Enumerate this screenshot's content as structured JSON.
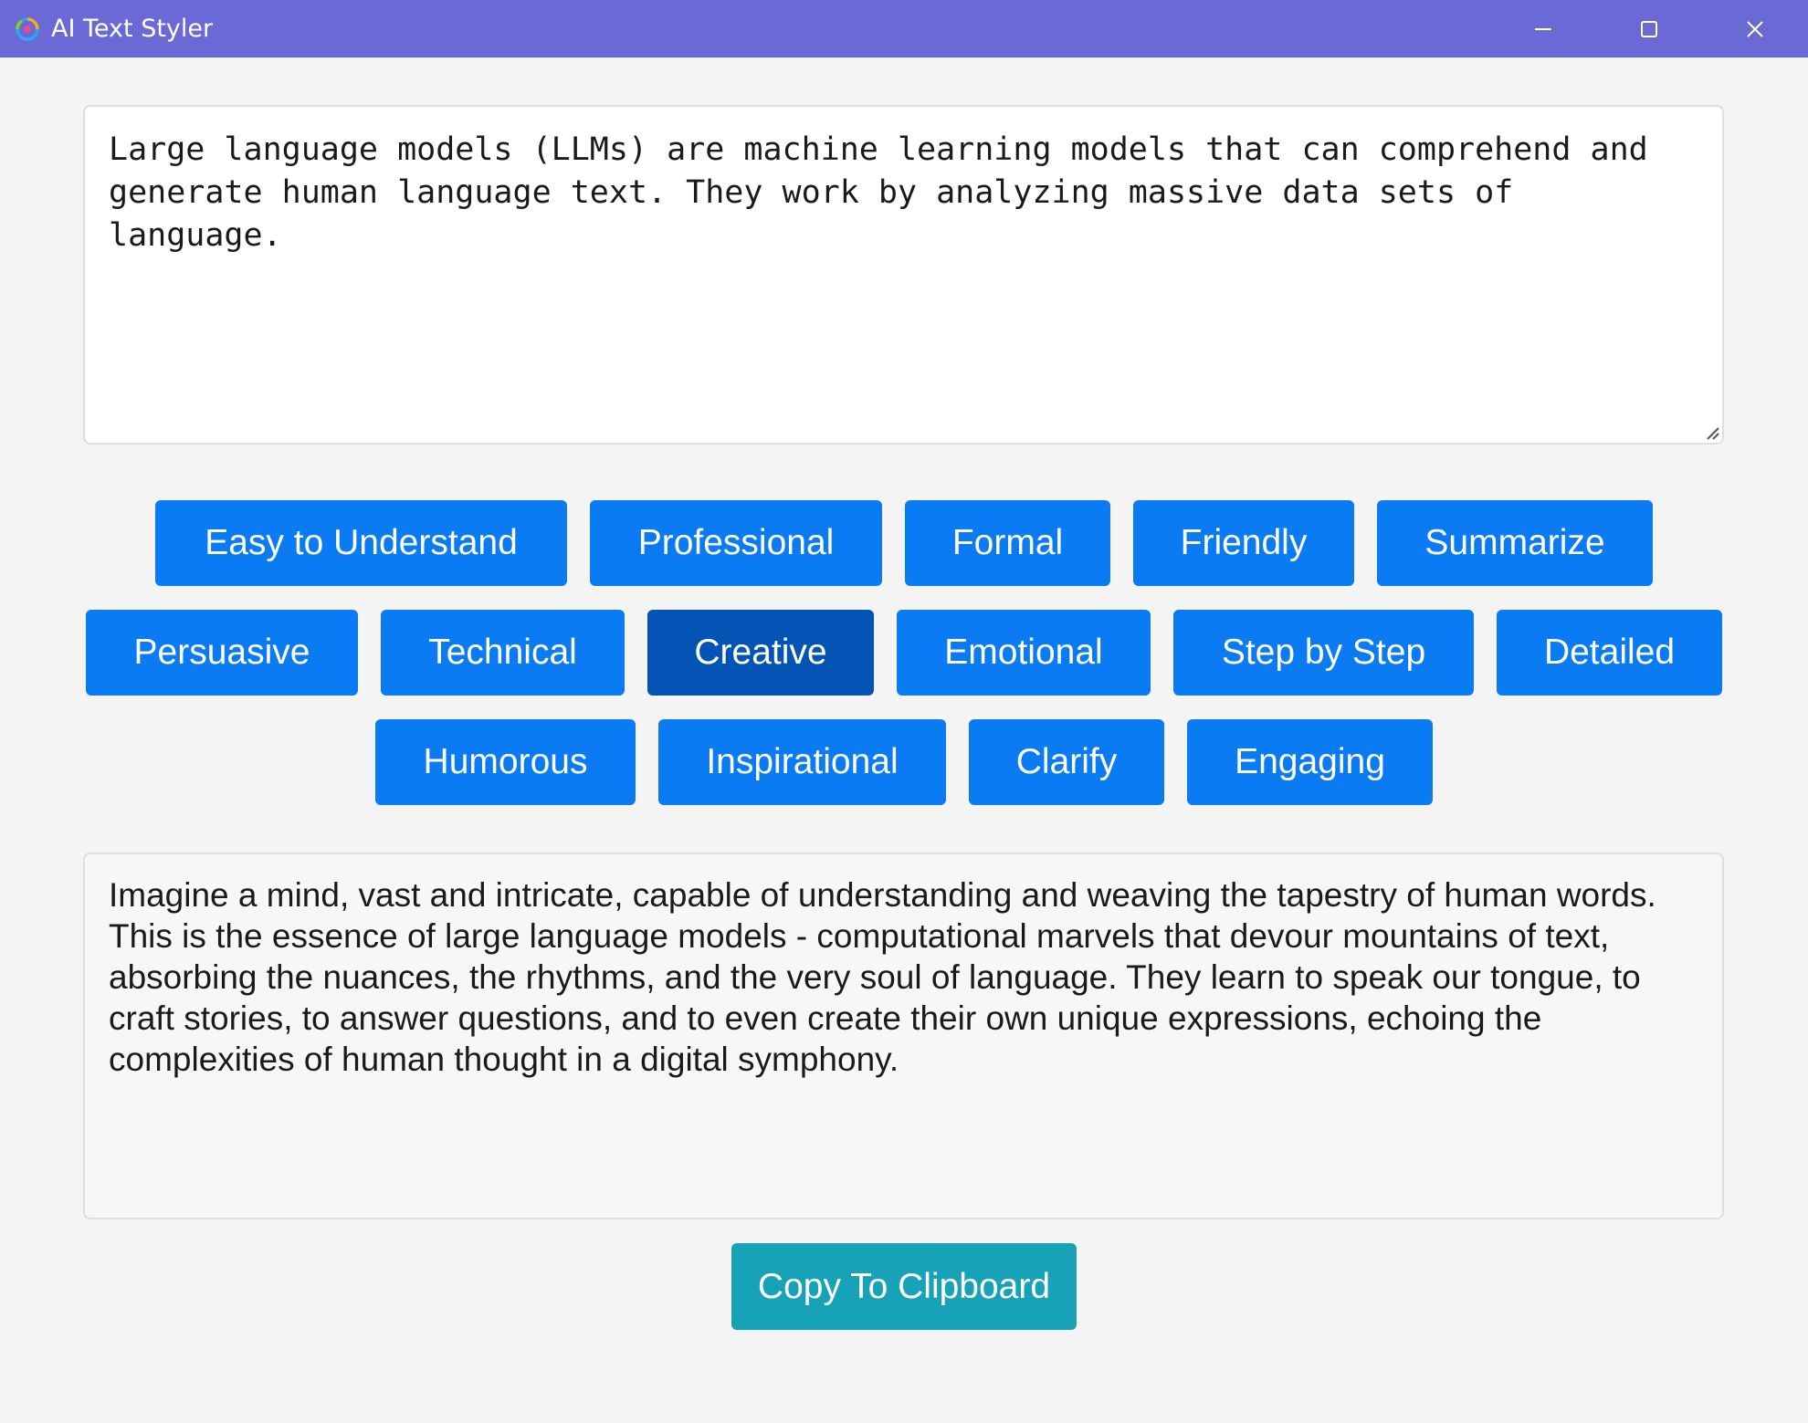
{
  "window": {
    "title": "AI Text Styler",
    "controls": [
      "minimize-icon",
      "maximize-icon",
      "close-icon"
    ]
  },
  "input": {
    "value": "Large language models (LLMs) are machine learning models that can comprehend and generate human language text. They work by analyzing massive data sets of language."
  },
  "styles": {
    "rows": [
      [
        "Easy to Understand",
        "Professional",
        "Formal",
        "Friendly",
        "Summarize"
      ],
      [
        "Persuasive",
        "Technical",
        "Creative",
        "Emotional",
        "Step by Step",
        "Detailed"
      ],
      [
        "Humorous",
        "Inspirational",
        "Clarify",
        "Engaging"
      ]
    ],
    "selected": "Creative"
  },
  "output": {
    "text": "Imagine a mind, vast and intricate, capable of understanding and weaving the tapestry of human words. This is the essence of large language models - computational marvels that devour mountains of text, absorbing the nuances, the rhythms, and the very soul of language. They learn to speak our tongue, to craft stories, to answer questions, and to even create their own unique expressions, echoing the complexities of human thought in a digital symphony."
  },
  "copy_button": {
    "label": "Copy To Clipboard"
  },
  "colors": {
    "titlebar": "#6b69d6",
    "button": "#0a7bf2",
    "button_selected": "#0454b5",
    "copy_button": "#17a2b8",
    "background": "#f4f4f4"
  }
}
